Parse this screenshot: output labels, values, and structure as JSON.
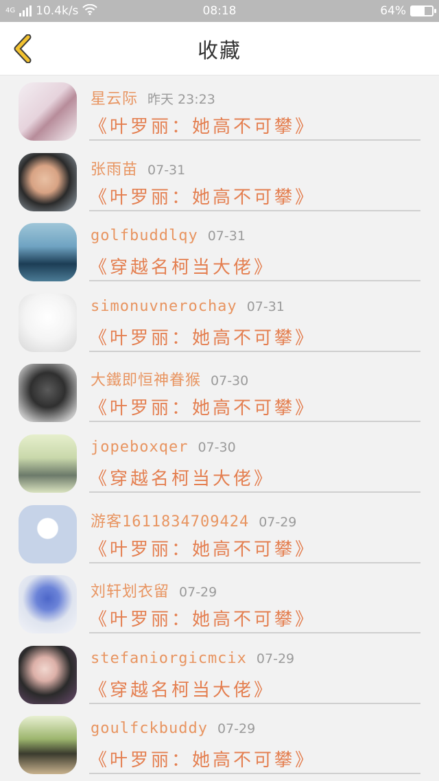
{
  "status_bar": {
    "network": "4G",
    "speed": "10.4k/s",
    "time": "08:18",
    "battery": "64%",
    "battery_level": 0.64
  },
  "header": {
    "title": "收藏",
    "back_icon": "chevron-left-icon",
    "accent": "#f2c230"
  },
  "colors": {
    "name_color": "#e89460",
    "book_color": "#e47f50",
    "date_color": "#9a9a9a"
  },
  "favorites": [
    {
      "name": "星云际",
      "date": "昨天 23:23",
      "book": "《叶罗丽：她高不可攀》"
    },
    {
      "name": "张雨苗",
      "date": "07-31",
      "book": "《叶罗丽：她高不可攀》"
    },
    {
      "name": "golfbuddlqy",
      "date": "07-31",
      "book": "《穿越名柯当大佬》"
    },
    {
      "name": "simonuvnerochay",
      "date": "07-31",
      "book": "《叶罗丽：她高不可攀》"
    },
    {
      "name": "大鐵即恒神眷猴",
      "date": "07-30",
      "book": "《叶罗丽：她高不可攀》"
    },
    {
      "name": "jopeboxqer",
      "date": "07-30",
      "book": "《穿越名柯当大佬》"
    },
    {
      "name": "游客1611834709424",
      "date": "07-29",
      "book": "《叶罗丽：她高不可攀》"
    },
    {
      "name": "刘轩划衣留",
      "date": "07-29",
      "book": "《叶罗丽：她高不可攀》"
    },
    {
      "name": "stefaniorgicmcix",
      "date": "07-29",
      "book": "《穿越名柯当大佬》"
    },
    {
      "name": "goulfckbuddy",
      "date": "07-29",
      "book": "《叶罗丽：她高不可攀》"
    }
  ]
}
